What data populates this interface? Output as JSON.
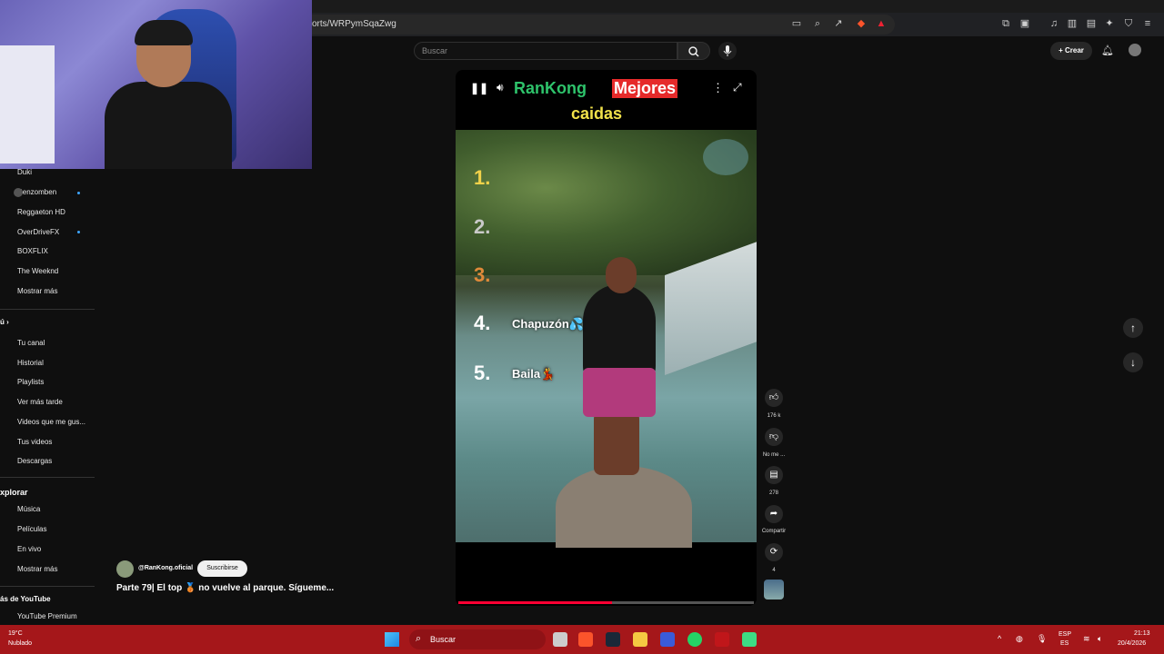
{
  "browser": {
    "url_fragment": "orts/WRPymSqaZwg"
  },
  "header": {
    "search_placeholder": "Buscar",
    "create_label": "+ Crear"
  },
  "sidebar": {
    "subscriptions": [
      {
        "label": "Duki",
        "live": false
      },
      {
        "label": "Renzomben",
        "live": true
      },
      {
        "label": "Reggaeton HD",
        "live": false
      },
      {
        "label": "OverDriveFX",
        "live": true
      },
      {
        "label": "BOXFLIX",
        "live": false
      },
      {
        "label": "The Weeknd",
        "live": false
      },
      {
        "label": "Mostrar más",
        "live": false
      }
    ],
    "you_section": [
      {
        "label": "Tu canal"
      },
      {
        "label": "Historial"
      },
      {
        "label": "Playlists"
      },
      {
        "label": "Ver más tarde"
      },
      {
        "label": "Videos que me gus..."
      },
      {
        "label": "Tus videos"
      },
      {
        "label": "Descargas"
      }
    ],
    "explore_heading": "xplorar",
    "explore": [
      {
        "label": "Música"
      },
      {
        "label": "Películas"
      },
      {
        "label": "En vivo"
      },
      {
        "label": "Mostrar más"
      }
    ],
    "more_heading": "ás de YouTube",
    "more": [
      {
        "label": "YouTube Premium"
      }
    ]
  },
  "player": {
    "title_part1": "RanKong",
    "title_part2": "Mejores",
    "title_line2": "caidas",
    "ranks": [
      {
        "num": "1.",
        "color": "#f2d24a",
        "label": ""
      },
      {
        "num": "2.",
        "color": "#c9c9c9",
        "label": ""
      },
      {
        "num": "3.",
        "color": "#e08a3a",
        "label": ""
      },
      {
        "num": "4.",
        "color": "#ffffff",
        "label": "Chapuzón💦"
      },
      {
        "num": "5.",
        "color": "#ffffff",
        "label": "Baila💃"
      }
    ],
    "progress": 0.52
  },
  "actions": {
    "likes": "176 k",
    "dislike": "No me ...",
    "comments": "278",
    "share": "Compartir",
    "remix": "4"
  },
  "short_info": {
    "channel": "@RanKong.oficial",
    "subscribe": "Suscribirse",
    "title": "Parte 79| El top 🥉 no vuelve al parque. Sígueme..."
  },
  "taskbar": {
    "weather_temp": "19°C",
    "weather_desc": "Nublado",
    "search_label": "Buscar",
    "lang1": "ESP",
    "lang2": "ES",
    "time": "21:13",
    "date": "20/4/2026"
  }
}
